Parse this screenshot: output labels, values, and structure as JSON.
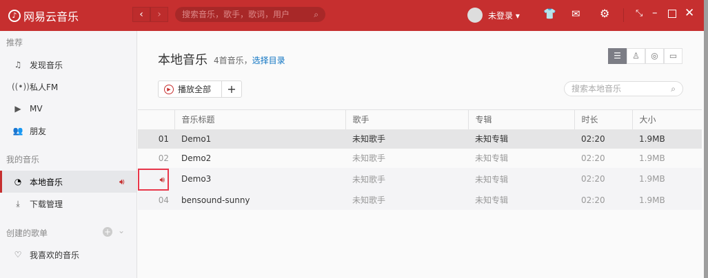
{
  "app": {
    "title": "网易云音乐",
    "search_placeholder": "搜索音乐，歌手，歌词，用户",
    "user": "未登录",
    "back": "‹",
    "forward": "›"
  },
  "sidebar": {
    "sections": [
      {
        "title": "推荐",
        "items": [
          {
            "label": "发现音乐",
            "icon": "music-note-icon"
          },
          {
            "label": "私人FM",
            "icon": "radio-icon"
          },
          {
            "label": "MV",
            "icon": "video-icon"
          },
          {
            "label": "朋友",
            "icon": "friends-icon"
          }
        ]
      },
      {
        "title": "我的音乐",
        "items": [
          {
            "label": "本地音乐",
            "icon": "local-music-icon",
            "active": true
          },
          {
            "label": "下载管理",
            "icon": "download-icon"
          }
        ]
      },
      {
        "title": "创建的歌单",
        "items": [
          {
            "label": "我喜欢的音乐",
            "icon": "heart-icon"
          }
        ]
      }
    ]
  },
  "main": {
    "title": "本地音乐",
    "count": "4首音乐，",
    "select_dir": "选择目录",
    "play_all": "播放全部",
    "add": "+",
    "search_placeholder": "搜索本地音乐",
    "columns": [
      "音乐标题",
      "歌手",
      "专辑",
      "时长",
      "大小"
    ],
    "rows": [
      {
        "idx": "01",
        "title": "Demo1",
        "artist": "未知歌手",
        "album": "未知专辑",
        "duration": "02:20",
        "size": "1.9MB"
      },
      {
        "idx": "02",
        "title": "Demo2",
        "artist": "未知歌手",
        "album": "未知专辑",
        "duration": "02:20",
        "size": "1.9MB"
      },
      {
        "idx": "",
        "title": "Demo3",
        "artist": "未知歌手",
        "album": "未知专辑",
        "duration": "02:20",
        "size": "1.9MB",
        "playing": true
      },
      {
        "idx": "04",
        "title": "bensound-sunny",
        "artist": "未知歌手",
        "album": "未知专辑",
        "duration": "02:20",
        "size": "1.9MB"
      }
    ]
  },
  "colors": {
    "brand": "#c62f2f"
  }
}
